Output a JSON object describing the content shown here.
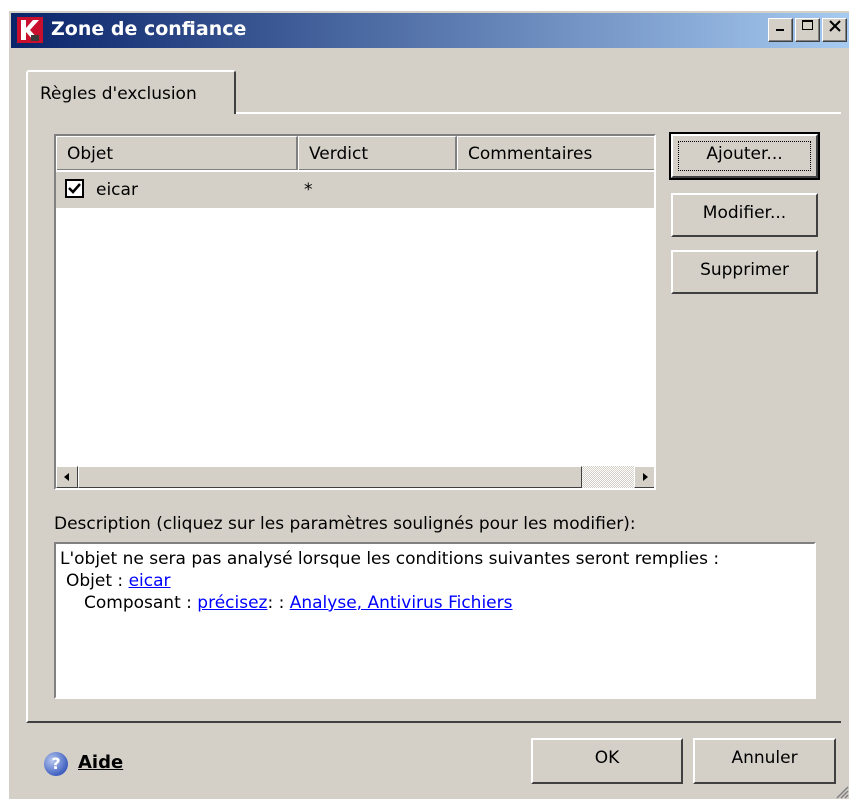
{
  "window": {
    "title": "Zone de confiance",
    "logo_icon": "kaspersky-k-logo",
    "controls": [
      "minimize-icon",
      "maximize-icon",
      "close-icon"
    ]
  },
  "tabs": [
    {
      "label": "Règles d'exclusion",
      "selected": true
    }
  ],
  "list": {
    "columns": [
      "Objet",
      "Verdict",
      "Commentaires"
    ],
    "rows": [
      {
        "checked": true,
        "object": "eicar",
        "verdict": "*",
        "comment": ""
      }
    ]
  },
  "buttons": {
    "add": "Ajouter...",
    "modify": "Modifier...",
    "delete": "Supprimer",
    "ok": "OK",
    "cancel": "Annuler",
    "help": "Aide"
  },
  "description": {
    "label": "Description (cliquez sur les paramètres soulignés pour les modifier):",
    "line1": "L'objet ne sera pas analysé lorsque les conditions suivantes seront remplies :",
    "object_prefix": "Objet :",
    "object_link": "eicar",
    "component_prefix": "Composant :",
    "component_link": "précisez",
    "component_sep": ":  :",
    "component_values_link": "Analyse, Antivirus Fichiers"
  },
  "colors": {
    "title_gradient_start": "#0a246a",
    "title_gradient_end": "#a6caf0",
    "face": "#d4d0c8",
    "link": "#0000ff",
    "logo": "#c8102e"
  }
}
